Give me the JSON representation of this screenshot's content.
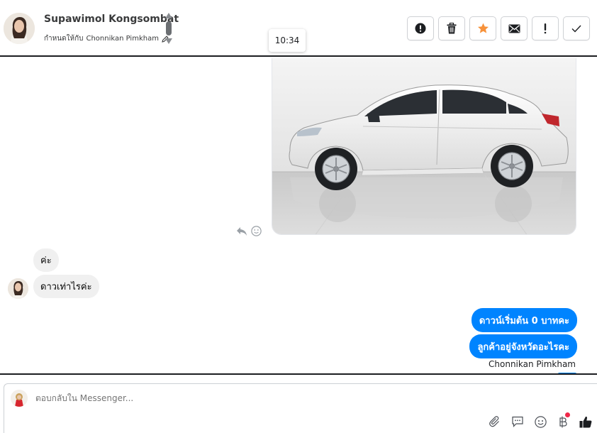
{
  "header": {
    "contact_name": "Supawimol Kongsombat",
    "assign_prefix": "กำหนดให้กับ",
    "assignee": "Chonnikan Pimkham",
    "actions": [
      {
        "name": "spam-button",
        "icon": "alert-circle-icon"
      },
      {
        "name": "delete-button",
        "icon": "trash-icon"
      },
      {
        "name": "star-button",
        "icon": "star-icon"
      },
      {
        "name": "mark-unread-button",
        "icon": "envelope-icon"
      },
      {
        "name": "follow-up-button",
        "icon": "exclamation-icon"
      },
      {
        "name": "done-button",
        "icon": "check-icon"
      }
    ]
  },
  "tooltip": {
    "time": "10:34"
  },
  "messages": {
    "incoming": [
      "ค่ะ",
      "ดาวเท่าไรค่ะ"
    ],
    "outgoing": [
      "ดาวน์เริ่มต้น  0 บาทคะ",
      "ลูกค้าอยู่จังหวัดอะไรคะ"
    ],
    "sender_name": "Chonnikan Pimkham"
  },
  "composer": {
    "placeholder": "ตอบกลับใน Messenger..."
  },
  "colors": {
    "outgoing_bubble": "#0084ff",
    "incoming_bubble": "#f0f0f0",
    "star": "#f7923a",
    "notification_dot": "#f02849"
  }
}
